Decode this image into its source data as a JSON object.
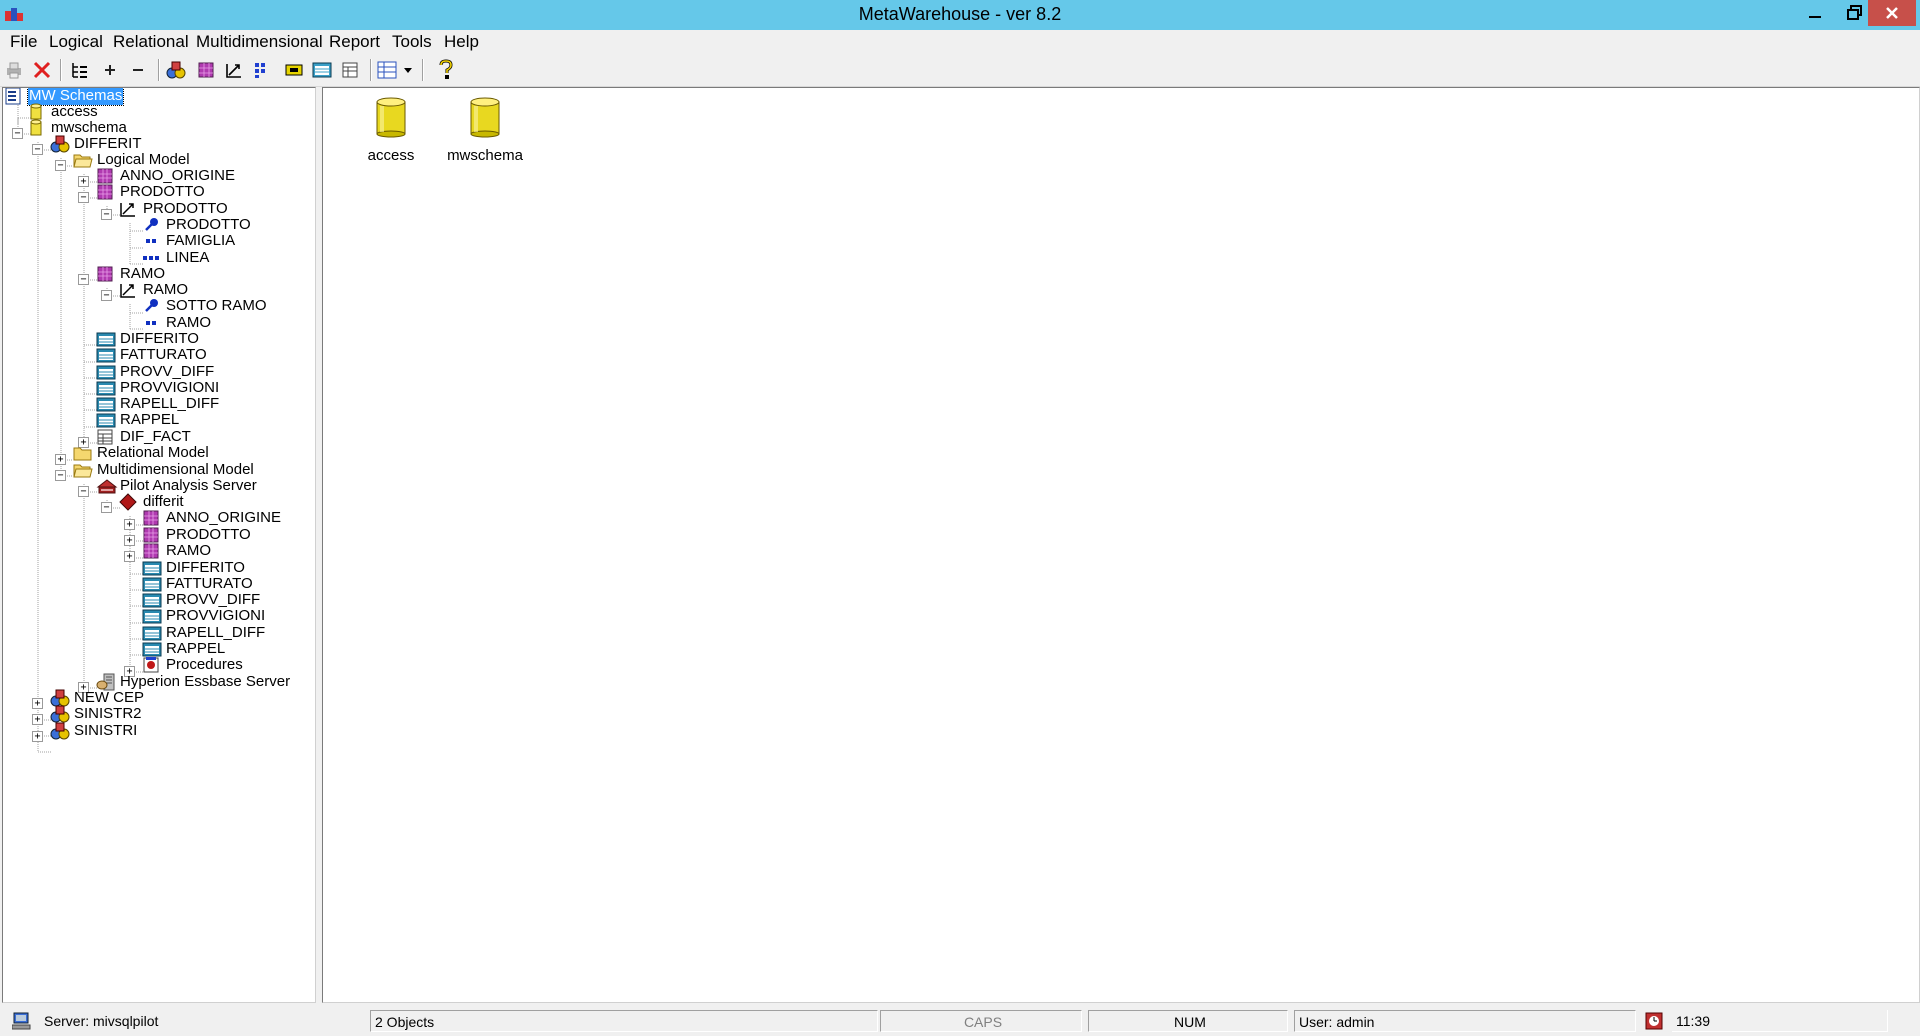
{
  "window": {
    "title": "MetaWarehouse - ver 8.2"
  },
  "menu": [
    "File",
    "Logical",
    "Relational",
    "Multidimensional",
    "Report",
    "Tools",
    "Help"
  ],
  "toolbar": {
    "buttons": [
      "print-icon",
      "delete-icon",
      "tree-view-icon",
      "expand-plus-icon",
      "collapse-minus-icon",
      "schema-icon",
      "dimension-cube-icon",
      "hierarchy-icon",
      "levels-icon",
      "fact-icon",
      "table-icon",
      "grid-icon",
      "view-dropdown-icon",
      "help-icon"
    ]
  },
  "tree": {
    "nodes": [
      {
        "label": "MW Schemas",
        "icon": "schemas-icon"
      },
      {
        "label": "access",
        "icon": "database-icon"
      },
      {
        "label": "mwschema",
        "icon": "database-icon"
      },
      {
        "label": "DIFFERIT",
        "icon": "shapes-icon"
      },
      {
        "label": "Logical Model",
        "icon": "folder-open-icon"
      },
      {
        "label": "ANNO_ORIGINE",
        "icon": "cube-icon"
      },
      {
        "label": "PRODOTTO",
        "icon": "cube-icon"
      },
      {
        "label": "PRODOTTO",
        "icon": "hierarchy-icon"
      },
      {
        "label": "PRODOTTO",
        "icon": "key-level-icon"
      },
      {
        "label": "FAMIGLIA",
        "icon": "level-icon"
      },
      {
        "label": "LINEA",
        "icon": "level-icon"
      },
      {
        "label": "RAMO",
        "icon": "cube-icon"
      },
      {
        "label": "RAMO",
        "icon": "hierarchy-icon"
      },
      {
        "label": "SOTTO RAMO",
        "icon": "key-level-icon"
      },
      {
        "label": "RAMO",
        "icon": "level-icon"
      },
      {
        "label": "DIFFERITO",
        "icon": "fact-icon"
      },
      {
        "label": "FATTURATO",
        "icon": "fact-icon"
      },
      {
        "label": "PROVV_DIFF",
        "icon": "fact-icon"
      },
      {
        "label": "PROVVIGIONI",
        "icon": "fact-icon"
      },
      {
        "label": "RAPELL_DIFF",
        "icon": "fact-icon"
      },
      {
        "label": "RAPPEL",
        "icon": "fact-icon"
      },
      {
        "label": "DIF_FACT",
        "icon": "table-icon"
      },
      {
        "label": "Relational Model",
        "icon": "folder-icon"
      },
      {
        "label": "Multidimensional Model",
        "icon": "folder-open-icon"
      },
      {
        "label": "Pilot Analysis Server",
        "icon": "server-icon"
      },
      {
        "label": "differit",
        "icon": "diamond-icon"
      },
      {
        "label": "ANNO_ORIGINE",
        "icon": "cube-icon"
      },
      {
        "label": "PRODOTTO",
        "icon": "cube-icon"
      },
      {
        "label": "RAMO",
        "icon": "cube-icon"
      },
      {
        "label": "DIFFERITO",
        "icon": "fact-icon"
      },
      {
        "label": "FATTURATO",
        "icon": "fact-icon"
      },
      {
        "label": "PROVV_DIFF",
        "icon": "fact-icon"
      },
      {
        "label": "PROVVIGIONI",
        "icon": "fact-icon"
      },
      {
        "label": "RAPELL_DIFF",
        "icon": "fact-icon"
      },
      {
        "label": "RAPPEL",
        "icon": "fact-icon"
      },
      {
        "label": "Procedures",
        "icon": "procedures-icon"
      },
      {
        "label": "Hyperion Essbase Server",
        "icon": "essbase-icon"
      },
      {
        "label": "NEW CEP",
        "icon": "shapes-icon"
      },
      {
        "label": "SINISTR2",
        "icon": "shapes-icon"
      },
      {
        "label": "SINISTRI",
        "icon": "shapes-icon"
      }
    ]
  },
  "listview": {
    "items": [
      {
        "label": "access",
        "icon": "database-icon"
      },
      {
        "label": "mwschema",
        "icon": "database-icon"
      }
    ]
  },
  "status": {
    "server": "Server: mivsqlpilot",
    "objects": "2 Objects",
    "caps": "CAPS",
    "num": "NUM",
    "user": "User: admin",
    "time": "11:39"
  },
  "colors": {
    "titlebar": "#65c8e9",
    "selection": "#3399ff",
    "close": "#c7504a"
  }
}
